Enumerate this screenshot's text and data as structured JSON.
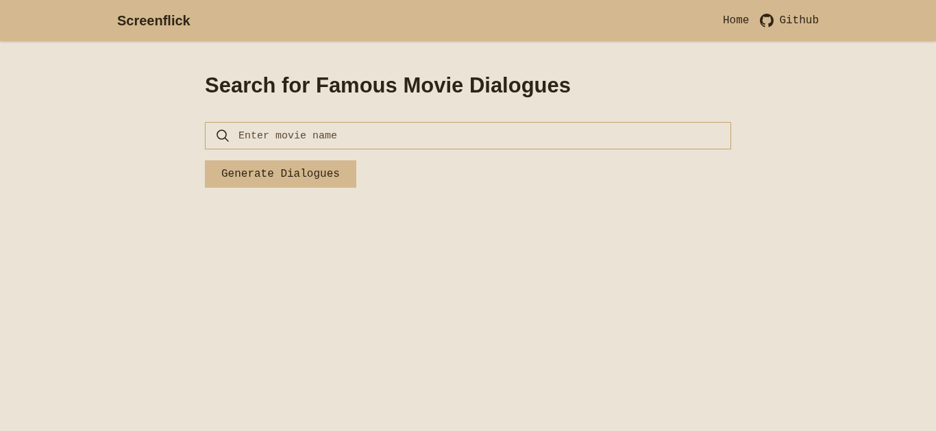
{
  "header": {
    "logo": "Screenflick",
    "nav": [
      {
        "label": "Home",
        "kind": "text"
      },
      {
        "label": "Github",
        "kind": "github"
      }
    ]
  },
  "main": {
    "title": "Search for Famous Movie Dialogues",
    "search": {
      "placeholder": "Enter movie name"
    },
    "button": "Generate Dialogues"
  }
}
